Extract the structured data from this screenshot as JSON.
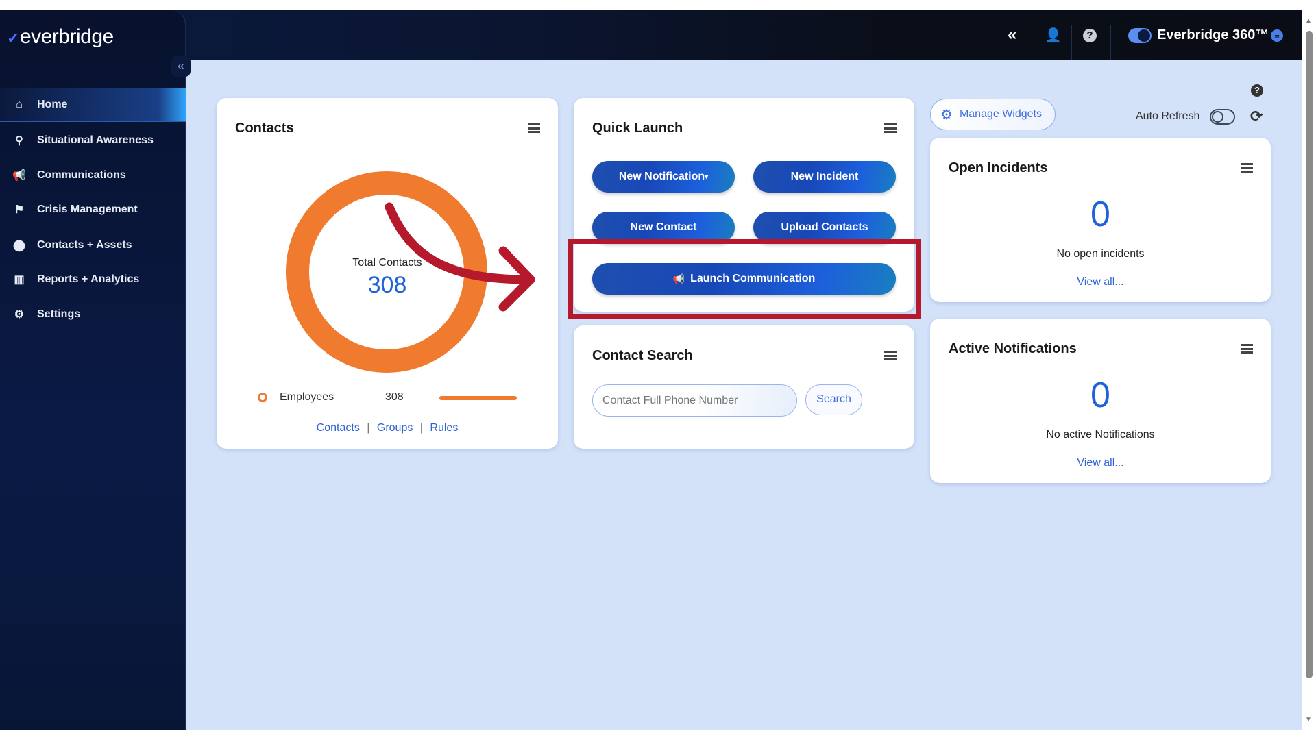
{
  "brand": {
    "logo": "everbridge",
    "product": "Everbridge 360™"
  },
  "sidebar": {
    "collapse": "«",
    "items": [
      {
        "label": "Home",
        "icon": "home-icon",
        "glyph": "⌂"
      },
      {
        "label": "Situational Awareness",
        "icon": "map-icon",
        "glyph": "⚲"
      },
      {
        "label": "Communications",
        "icon": "megaphone-icon",
        "glyph": "📢"
      },
      {
        "label": "Crisis Management",
        "icon": "crisis-icon",
        "glyph": "⚑"
      },
      {
        "label": "Contacts + Assets",
        "icon": "map-pin-icon",
        "glyph": "⬤"
      },
      {
        "label": "Reports + Analytics",
        "icon": "chart-icon",
        "glyph": "▥"
      },
      {
        "label": "Settings",
        "icon": "gear-icon",
        "glyph": "⚙"
      }
    ]
  },
  "header": {
    "collapse": "«",
    "user": "👤",
    "help": "?",
    "chat": "≡"
  },
  "toolbar": {
    "manage_widgets": "Manage Widgets",
    "auto_refresh": "Auto Refresh",
    "help": "?",
    "refresh": "⟳",
    "gear": "⚙"
  },
  "contacts": {
    "title": "Contacts",
    "total_label": "Total Contacts",
    "total": "308",
    "legend": [
      {
        "label": "Employees",
        "value": "308",
        "share": 1.0
      }
    ],
    "links": [
      "Contacts",
      "Groups",
      "Rules"
    ],
    "sep": "|",
    "color": "#f07a2e"
  },
  "quick_launch": {
    "title": "Quick Launch",
    "buttons": [
      "New Notification",
      "New Incident",
      "New Contact",
      "Upload Contacts"
    ],
    "launch": "Launch Communication"
  },
  "contact_search": {
    "title": "Contact Search",
    "placeholder": "Contact Full Phone Number",
    "search": "Search"
  },
  "open_incidents": {
    "title": "Open Incidents",
    "count": "0",
    "text": "No open incidents",
    "link": "View all..."
  },
  "active_notifications": {
    "title": "Active Notifications",
    "count": "0",
    "text": "No active Notifications",
    "link": "View all..."
  },
  "annotation": {
    "color": "#b5192b"
  }
}
